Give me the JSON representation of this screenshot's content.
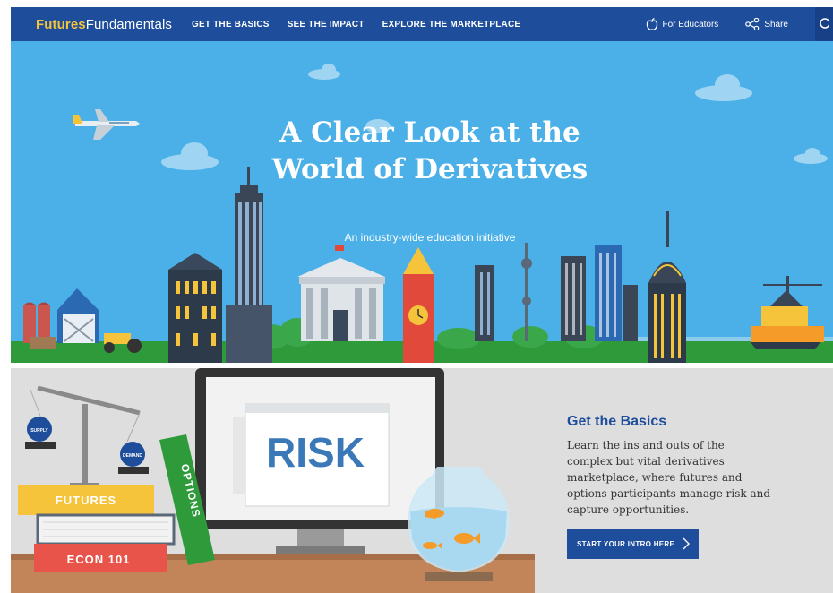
{
  "nav": {
    "logo_part1": "Futures",
    "logo_part2": "Fundamentals",
    "links": [
      "GET THE BASICS",
      "SEE THE IMPACT",
      "EXPLORE THE MARKETPLACE"
    ],
    "educators_label": "For Educators",
    "share_label": "Share"
  },
  "hero": {
    "title": "A Clear Look at the World of Derivatives",
    "subtitle": "An industry-wide education initiative"
  },
  "illustration": {
    "books": [
      "FUTURES",
      "OPTIONS",
      "ECON 101"
    ],
    "monitor_text": "RISK",
    "scale_labels": [
      "SUPPLY",
      "DEMAND"
    ]
  },
  "basics": {
    "title": "Get the Basics",
    "text": "Learn the ins and outs of the complex but vital derivatives marketplace, where futures and options participants manage risk and capture opportunities.",
    "button_label": "START YOUR INTRO HERE"
  },
  "colors": {
    "nav_bg": "#1d4d9b",
    "logo_accent": "#f5c43a",
    "sky": "#4bb0e8",
    "grass": "#2e9a3a",
    "panel_bg": "#dedede"
  },
  "icons": [
    "apple-icon",
    "share-icon",
    "search-icon",
    "chevron-right-icon"
  ]
}
